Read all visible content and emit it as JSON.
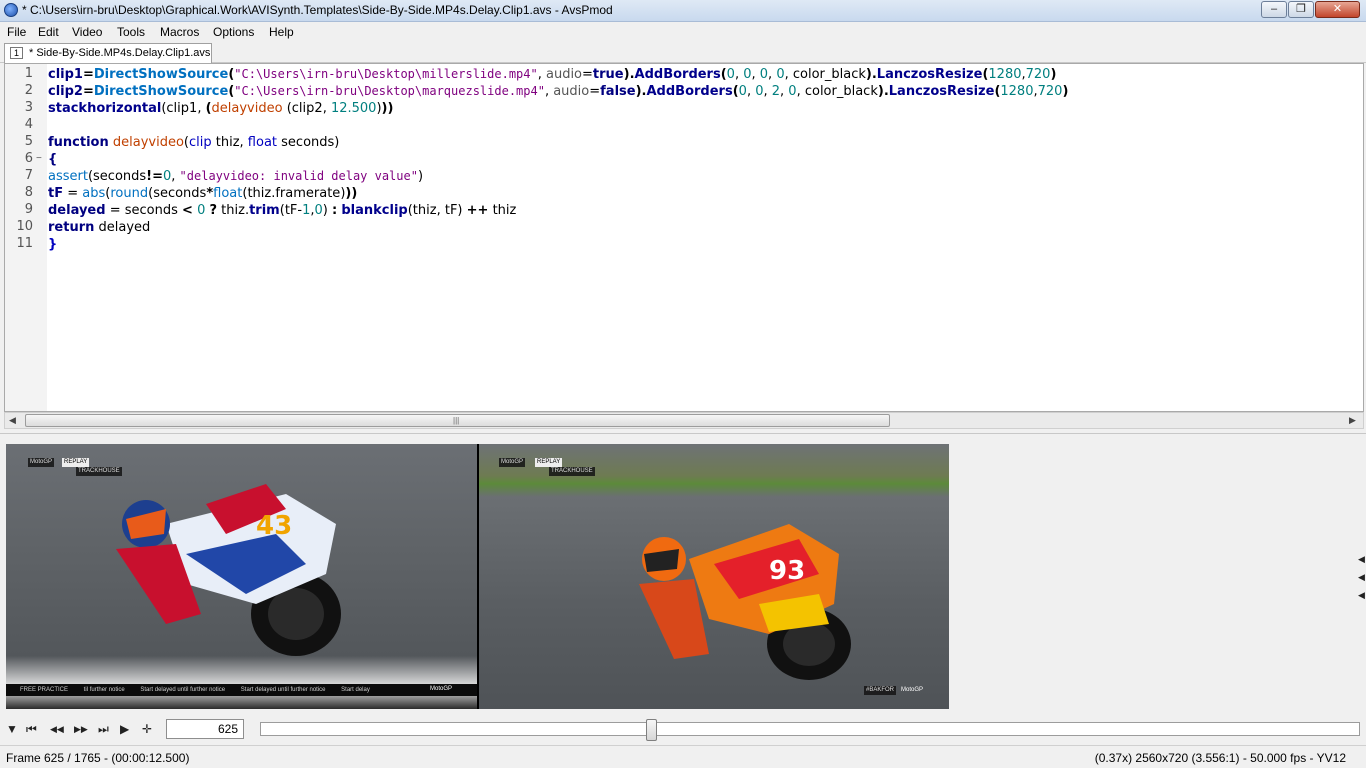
{
  "window": {
    "title": "* C:\\Users\\irn-bru\\Desktop\\Graphical.Work\\AVISynth.Templates\\Side-By-Side.MP4s.Delay.Clip1.avs - AvsPmod",
    "min_glyph": "‒",
    "max_glyph": "❐",
    "close_glyph": "✕"
  },
  "menu": [
    "File",
    "Edit",
    "Video",
    "Tools",
    "Macros",
    "Options",
    "Help"
  ],
  "tab": {
    "number": "1",
    "label": "* Side-By-Side.MP4s.Delay.Clip1.avs"
  },
  "editor": {
    "line_numbers": [
      "1",
      "2",
      "3",
      "4",
      "5",
      "6",
      "7",
      "8",
      "9",
      "10",
      "11"
    ],
    "lines": {
      "l1": {
        "var": "clip1",
        "fn": "DirectShowSource",
        "path": "\"C:\\Users\\irn-bru\\Desktop\\millerslide.mp4\"",
        "audio_arg": "audio",
        "audio_val": "true",
        "borders_fn": "AddBorders",
        "b1": "0",
        "b2": "0",
        "b3": "0",
        "b4": "0",
        "color_arg": "color_black",
        "resize_fn": "LanczosResize",
        "w": "1280",
        "h": "720"
      },
      "l2": {
        "var": "clip2",
        "fn": "DirectShowSource",
        "path": "\"C:\\Users\\irn-bru\\Desktop\\marquezslide.mp4\"",
        "audio_arg": "audio",
        "audio_val": "false",
        "borders_fn": "AddBorders",
        "b1": "0",
        "b2": "0",
        "b3": "2",
        "b4": "0",
        "color_arg": "color_black",
        "resize_fn": "LanczosResize",
        "w": "1280",
        "h": "720"
      },
      "l3": {
        "fn": "stackhorizontal",
        "a1": "clip1",
        "user_fn": "delayvideo",
        "a2": "clip2",
        "num": "12.500"
      },
      "l5": {
        "kw": "function",
        "name": "delayvideo",
        "t1": "clip",
        "p1": "thiz",
        "t2": "float",
        "p2": "seconds"
      },
      "l6": {
        "brace": "{"
      },
      "l7": {
        "fn": "assert",
        "arg": "seconds",
        "op": "!=",
        "num": "0",
        "msg": "\"delayvideo: invalid delay value\""
      },
      "l8": {
        "var": "tF",
        "f1": "abs",
        "f2": "round",
        "a1": "seconds",
        "f3": "float",
        "a2": "thiz.framerate"
      },
      "l9": {
        "var": "delayed",
        "a1": "seconds",
        "num0": "0",
        "a2": "thiz",
        "f1": "trim",
        "a3": "tF",
        "num1": "1",
        "num2": "0",
        "f2": "blankclip",
        "a4": "thiz",
        "a5": "tF",
        "a6": "thiz"
      },
      "l10": {
        "kw": "return",
        "var": "delayed"
      },
      "l11": {
        "brace": "}"
      }
    },
    "scroll_grip": "|||"
  },
  "preview": {
    "left_clip": {
      "badge1": "MotoGP",
      "badge2": "REPLAY",
      "badge3": "TRACKHOUSE",
      "ticker": [
        "FREE PRACTICE",
        "til further notice",
        "Start delayed until further notice",
        "Start delayed until further notice",
        "Start delay"
      ],
      "logo": "MotoGP"
    },
    "right_clip": {
      "badge1": "MotoGP",
      "badge2": "REPLAY",
      "badge3": "TRACKHOUSE",
      "corner": "#BAKFOR",
      "logo": "MotoGP"
    }
  },
  "playback": {
    "buttons": [
      "▼",
      "⏮",
      "◀◀",
      "▶▶",
      "⏭",
      "▶",
      "✛"
    ],
    "frame_value": "625",
    "seek_fraction": 0.354
  },
  "status": {
    "left": "Frame 625 / 1765  -  (00:00:12.500)",
    "right": "(0.37x)  2560x720 (3.556:1)  -  50.000 fps  -  YV12"
  }
}
